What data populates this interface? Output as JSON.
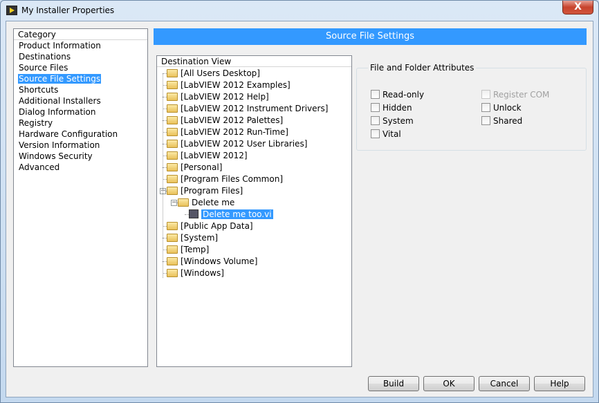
{
  "window": {
    "title": "My Installer Properties",
    "close": "X"
  },
  "category": {
    "header": "Category",
    "items": [
      "Product Information",
      "Destinations",
      "Source Files",
      "Source File Settings",
      "Shortcuts",
      "Additional Installers",
      "Dialog Information",
      "Registry",
      "Hardware Configuration",
      "Version Information",
      "Windows Security",
      "Advanced"
    ],
    "selected": "Source File Settings"
  },
  "banner": "Source File Settings",
  "tree": {
    "header": "Destination View",
    "items": [
      {
        "label": "[All Users Desktop]",
        "type": "folder",
        "level": 0
      },
      {
        "label": "[LabVIEW 2012 Examples]",
        "type": "folder",
        "level": 0
      },
      {
        "label": "[LabVIEW 2012 Help]",
        "type": "folder",
        "level": 0
      },
      {
        "label": "[LabVIEW 2012 Instrument Drivers]",
        "type": "folder",
        "level": 0
      },
      {
        "label": "[LabVIEW 2012 Palettes]",
        "type": "folder",
        "level": 0
      },
      {
        "label": "[LabVIEW 2012 Run-Time]",
        "type": "folder",
        "level": 0
      },
      {
        "label": "[LabVIEW 2012 User Libraries]",
        "type": "folder",
        "level": 0
      },
      {
        "label": "[LabVIEW 2012]",
        "type": "folder",
        "level": 0
      },
      {
        "label": "[Personal]",
        "type": "folder",
        "level": 0
      },
      {
        "label": "[Program Files Common]",
        "type": "folder",
        "level": 0
      },
      {
        "label": "[Program Files]",
        "type": "folder",
        "level": 0,
        "expanded": true
      },
      {
        "label": "Delete me",
        "type": "folder",
        "level": 1,
        "expanded": true
      },
      {
        "label": "Delete me too.vi",
        "type": "vi",
        "level": 2,
        "selected": true
      },
      {
        "label": "[Public App Data]",
        "type": "folder",
        "level": 0
      },
      {
        "label": "[System]",
        "type": "folder",
        "level": 0
      },
      {
        "label": "[Temp]",
        "type": "folder",
        "level": 0
      },
      {
        "label": "[Windows Volume]",
        "type": "folder",
        "level": 0
      },
      {
        "label": "[Windows]",
        "type": "folder",
        "level": 0
      }
    ]
  },
  "attributes": {
    "legend": "File and Folder Attributes",
    "left": [
      {
        "label": "Read-only",
        "checked": false
      },
      {
        "label": "Hidden",
        "checked": false
      },
      {
        "label": "System",
        "checked": false
      },
      {
        "label": "Vital",
        "checked": false
      }
    ],
    "right": [
      {
        "label": "Register COM",
        "checked": false,
        "disabled": true
      },
      {
        "label": "Unlock",
        "checked": false
      },
      {
        "label": "Shared",
        "checked": false
      }
    ]
  },
  "buttons": {
    "build": "Build",
    "ok": "OK",
    "cancel": "Cancel",
    "help": "Help"
  },
  "colors": {
    "selection": "#3399ff"
  }
}
